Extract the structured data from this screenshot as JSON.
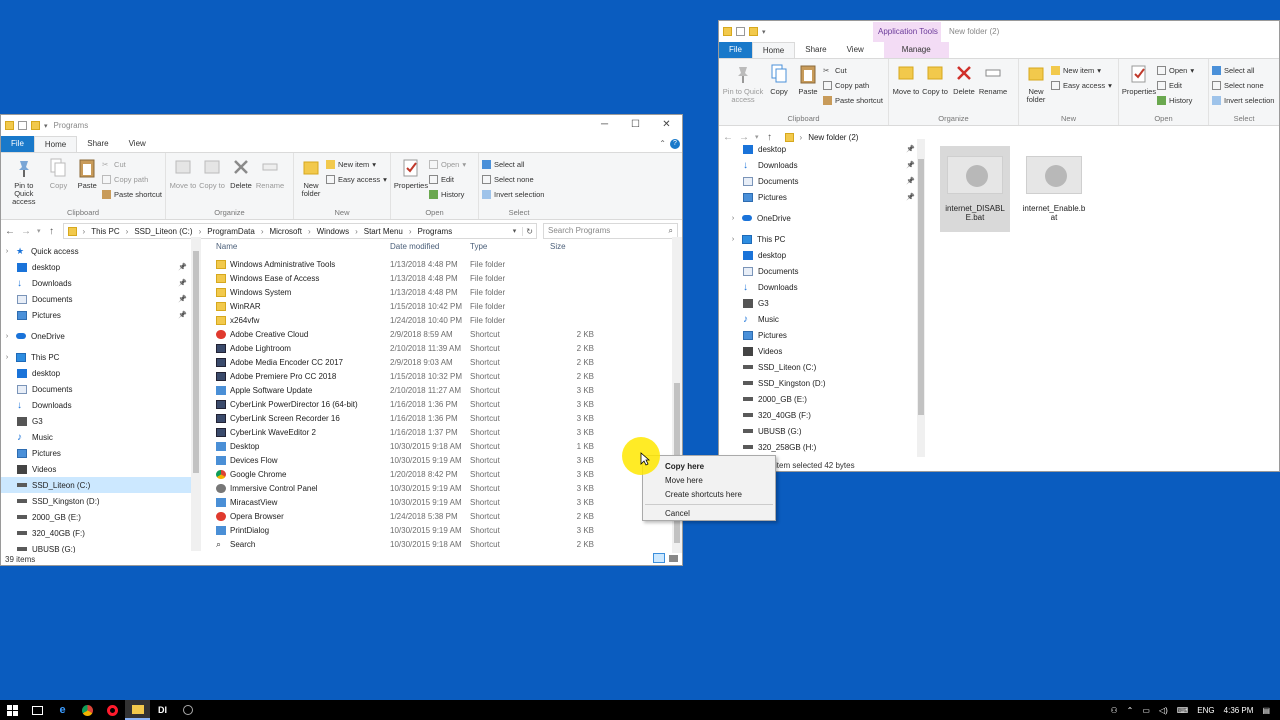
{
  "left": {
    "title": "Programs",
    "tabs": [
      "File",
      "Home",
      "Share",
      "View"
    ],
    "ribbon": {
      "clipboard": {
        "label": "Clipboard",
        "pin": "Pin to Quick access",
        "copy": "Copy",
        "paste": "Paste",
        "cut": "Cut",
        "copy_path": "Copy path",
        "paste_shortcut": "Paste shortcut"
      },
      "organize": {
        "label": "Organize",
        "move": "Move to",
        "copy": "Copy to",
        "delete": "Delete",
        "rename": "Rename"
      },
      "new": {
        "label": "New",
        "new_folder": "New folder",
        "new_item": "New item",
        "easy_access": "Easy access"
      },
      "open": {
        "label": "Open",
        "properties": "Properties",
        "open": "Open",
        "edit": "Edit",
        "history": "History"
      },
      "select": {
        "label": "Select",
        "select_all": "Select all",
        "select_none": "Select none",
        "invert": "Invert selection"
      }
    },
    "address": [
      "This PC",
      "SSD_Liteon (C:)",
      "ProgramData",
      "Microsoft",
      "Windows",
      "Start Menu",
      "Programs"
    ],
    "search_placeholder": "Search Programs",
    "nav": [
      {
        "label": "Quick access",
        "icon": "star-icon",
        "indent": 0
      },
      {
        "label": "desktop",
        "icon": "desktop-icon",
        "indent": 1,
        "pin": true
      },
      {
        "label": "Downloads",
        "icon": "download-icon",
        "indent": 1,
        "pin": true
      },
      {
        "label": "Documents",
        "icon": "documents-icon",
        "indent": 1,
        "pin": true
      },
      {
        "label": "Pictures",
        "icon": "pictures-icon",
        "indent": 1,
        "pin": true
      },
      {
        "label": "OneDrive",
        "icon": "cloud-icon",
        "indent": 0
      },
      {
        "label": "This PC",
        "icon": "computer-icon",
        "indent": 0
      },
      {
        "label": "desktop",
        "icon": "desktop-icon",
        "indent": 1
      },
      {
        "label": "Documents",
        "icon": "documents-icon",
        "indent": 1
      },
      {
        "label": "Downloads",
        "icon": "download-icon",
        "indent": 1
      },
      {
        "label": "G3",
        "icon": "phone-icon",
        "indent": 1
      },
      {
        "label": "Music",
        "icon": "music-icon",
        "indent": 1
      },
      {
        "label": "Pictures",
        "icon": "pictures-icon",
        "indent": 1
      },
      {
        "label": "Videos",
        "icon": "videos-icon",
        "indent": 1
      },
      {
        "label": "SSD_Liteon (C:)",
        "icon": "drive-icon",
        "indent": 1,
        "selected": true
      },
      {
        "label": "SSD_Kingston (D:)",
        "icon": "drive-icon",
        "indent": 1
      },
      {
        "label": "2000_GB (E:)",
        "icon": "drive-icon",
        "indent": 1
      },
      {
        "label": "320_40GB (F:)",
        "icon": "drive-icon",
        "indent": 1
      },
      {
        "label": "UBUSB (G:)",
        "icon": "drive-icon",
        "indent": 1
      }
    ],
    "columns": {
      "name": "Name",
      "date": "Date modified",
      "type": "Type",
      "size": "Size"
    },
    "files": [
      {
        "name": "Windows Administrative Tools",
        "date": "1/13/2018 4:48 PM",
        "type": "File folder",
        "size": "",
        "icon": "folder"
      },
      {
        "name": "Windows Ease of Access",
        "date": "1/13/2018 4:48 PM",
        "type": "File folder",
        "size": "",
        "icon": "folder"
      },
      {
        "name": "Windows System",
        "date": "1/13/2018 4:48 PM",
        "type": "File folder",
        "size": "",
        "icon": "folder"
      },
      {
        "name": "WinRAR",
        "date": "1/15/2018 10:42 PM",
        "type": "File folder",
        "size": "",
        "icon": "folder"
      },
      {
        "name": "x264vfw",
        "date": "1/24/2018 10:40 PM",
        "type": "File folder",
        "size": "",
        "icon": "folder"
      },
      {
        "name": "Adobe Creative Cloud",
        "date": "2/9/2018 8:59 AM",
        "type": "Shortcut",
        "size": "2 KB",
        "icon": "red"
      },
      {
        "name": "Adobe Lightroom",
        "date": "2/10/2018 11:39 AM",
        "type": "Shortcut",
        "size": "2 KB",
        "icon": "short"
      },
      {
        "name": "Adobe Media Encoder CC 2017",
        "date": "2/9/2018 9:03 AM",
        "type": "Shortcut",
        "size": "2 KB",
        "icon": "short"
      },
      {
        "name": "Adobe Premiere Pro CC 2018",
        "date": "1/15/2018 10:32 PM",
        "type": "Shortcut",
        "size": "2 KB",
        "icon": "short"
      },
      {
        "name": "Apple Software Update",
        "date": "2/10/2018 11:27 AM",
        "type": "Shortcut",
        "size": "3 KB",
        "icon": "cp"
      },
      {
        "name": "CyberLink PowerDirector 16 (64-bit)",
        "date": "1/16/2018 1:36 PM",
        "type": "Shortcut",
        "size": "3 KB",
        "icon": "short"
      },
      {
        "name": "CyberLink Screen Recorder 16",
        "date": "1/16/2018 1:36 PM",
        "type": "Shortcut",
        "size": "3 KB",
        "icon": "short"
      },
      {
        "name": "CyberLink WaveEditor 2",
        "date": "1/16/2018 1:37 PM",
        "type": "Shortcut",
        "size": "3 KB",
        "icon": "short"
      },
      {
        "name": "Desktop",
        "date": "10/30/2015 9:18 AM",
        "type": "Shortcut",
        "size": "1 KB",
        "icon": "cp"
      },
      {
        "name": "Devices Flow",
        "date": "10/30/2015 9:19 AM",
        "type": "Shortcut",
        "size": "3 KB",
        "icon": "cp"
      },
      {
        "name": "Google Chrome",
        "date": "1/20/2018 8:42 PM",
        "type": "Shortcut",
        "size": "3 KB",
        "icon": "chrome"
      },
      {
        "name": "Immersive Control Panel",
        "date": "10/30/2015 9:19 AM",
        "type": "Shortcut",
        "size": "3 KB",
        "icon": "gear"
      },
      {
        "name": "MiracastView",
        "date": "10/30/2015 9:19 AM",
        "type": "Shortcut",
        "size": "3 KB",
        "icon": "cp"
      },
      {
        "name": "Opera Browser",
        "date": "1/24/2018 5:38 PM",
        "type": "Shortcut",
        "size": "2 KB",
        "icon": "red"
      },
      {
        "name": "PrintDialog",
        "date": "10/30/2015 9:19 AM",
        "type": "Shortcut",
        "size": "3 KB",
        "icon": "cp"
      },
      {
        "name": "Search",
        "date": "10/30/2015 9:18 AM",
        "type": "Shortcut",
        "size": "2 KB",
        "icon": "srch"
      }
    ],
    "status": "39 items"
  },
  "right": {
    "title": "New folder (2)",
    "context_tab": "Application Tools",
    "tabs": [
      "File",
      "Home",
      "Share",
      "View",
      "Manage"
    ],
    "ribbon": {
      "clipboard": {
        "label": "Clipboard",
        "pin": "Pin to Quick access",
        "copy": "Copy",
        "paste": "Paste",
        "cut": "Cut",
        "copy_path": "Copy path",
        "paste_shortcut": "Paste shortcut"
      },
      "organize": {
        "label": "Organize",
        "move": "Move to",
        "copy": "Copy to",
        "delete": "Delete",
        "rename": "Rename"
      },
      "new": {
        "label": "New",
        "new_folder": "New folder",
        "new_item": "New item",
        "easy_access": "Easy access"
      },
      "open": {
        "label": "Open",
        "properties": "Properties",
        "open": "Open",
        "edit": "Edit",
        "history": "History"
      },
      "select": {
        "label": "Select",
        "select_all": "Select all",
        "select_none": "Select none",
        "invert": "Invert selection"
      }
    },
    "address": [
      "New folder (2)"
    ],
    "nav": [
      {
        "label": "desktop",
        "icon": "desktop-icon",
        "indent": 1,
        "pin": true
      },
      {
        "label": "Downloads",
        "icon": "download-icon",
        "indent": 1,
        "pin": true
      },
      {
        "label": "Documents",
        "icon": "documents-icon",
        "indent": 1,
        "pin": true
      },
      {
        "label": "Pictures",
        "icon": "pictures-icon",
        "indent": 1,
        "pin": true
      },
      {
        "label": "OneDrive",
        "icon": "cloud-icon",
        "indent": 0
      },
      {
        "label": "This PC",
        "icon": "computer-icon",
        "indent": 0
      },
      {
        "label": "desktop",
        "icon": "desktop-icon",
        "indent": 1
      },
      {
        "label": "Documents",
        "icon": "documents-icon",
        "indent": 1
      },
      {
        "label": "Downloads",
        "icon": "download-icon",
        "indent": 1
      },
      {
        "label": "G3",
        "icon": "phone-icon",
        "indent": 1
      },
      {
        "label": "Music",
        "icon": "music-icon",
        "indent": 1
      },
      {
        "label": "Pictures",
        "icon": "pictures-icon",
        "indent": 1
      },
      {
        "label": "Videos",
        "icon": "videos-icon",
        "indent": 1
      },
      {
        "label": "SSD_Liteon (C:)",
        "icon": "drive-icon",
        "indent": 1
      },
      {
        "label": "SSD_Kingston (D:)",
        "icon": "drive-icon",
        "indent": 1
      },
      {
        "label": "2000_GB (E:)",
        "icon": "drive-icon",
        "indent": 1
      },
      {
        "label": "320_40GB (F:)",
        "icon": "drive-icon",
        "indent": 1
      },
      {
        "label": "UBUSB (G:)",
        "icon": "drive-icon",
        "indent": 1
      },
      {
        "label": "320_258GB (H:)",
        "icon": "drive-icon",
        "indent": 1
      }
    ],
    "files": [
      {
        "name": "internet_DISABLE.bat",
        "selected": true
      },
      {
        "name": "internet_Enable.bat",
        "selected": false
      }
    ],
    "status": "item selected  42 bytes"
  },
  "context_menu": {
    "items": [
      "Copy here",
      "Move here",
      "Create shortcuts here"
    ],
    "cancel": "Cancel"
  },
  "taskbar": {
    "language": "ENG",
    "time": "4:36 PM"
  }
}
